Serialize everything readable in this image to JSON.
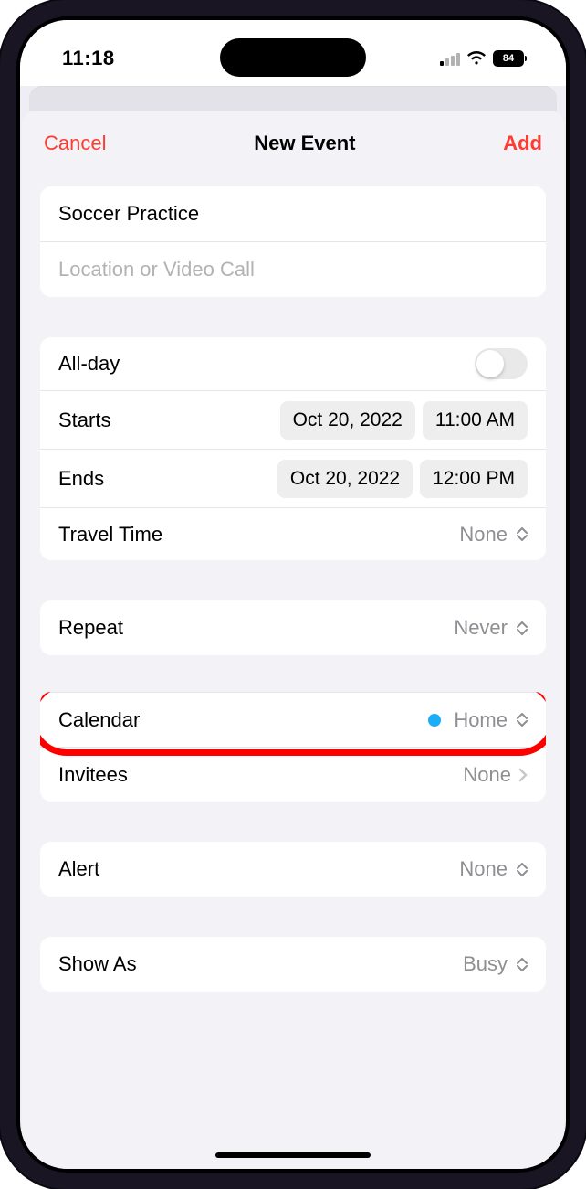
{
  "status": {
    "time": "11:18",
    "battery": "84"
  },
  "header": {
    "cancel": "Cancel",
    "title": "New Event",
    "add": "Add"
  },
  "event": {
    "title": "Soccer Practice",
    "location_placeholder": "Location or Video Call"
  },
  "time": {
    "allday_label": "All-day",
    "starts_label": "Starts",
    "starts_date": "Oct 20, 2022",
    "starts_time": "11:00 AM",
    "ends_label": "Ends",
    "ends_date": "Oct 20, 2022",
    "ends_time": "12:00 PM",
    "travel_label": "Travel Time",
    "travel_value": "None"
  },
  "repeat": {
    "label": "Repeat",
    "value": "Never"
  },
  "calendar": {
    "label": "Calendar",
    "value": "Home",
    "dot_color": "#1badf8"
  },
  "invitees": {
    "label": "Invitees",
    "value": "None"
  },
  "alert": {
    "label": "Alert",
    "value": "None"
  },
  "showas": {
    "label": "Show As",
    "value": "Busy"
  }
}
